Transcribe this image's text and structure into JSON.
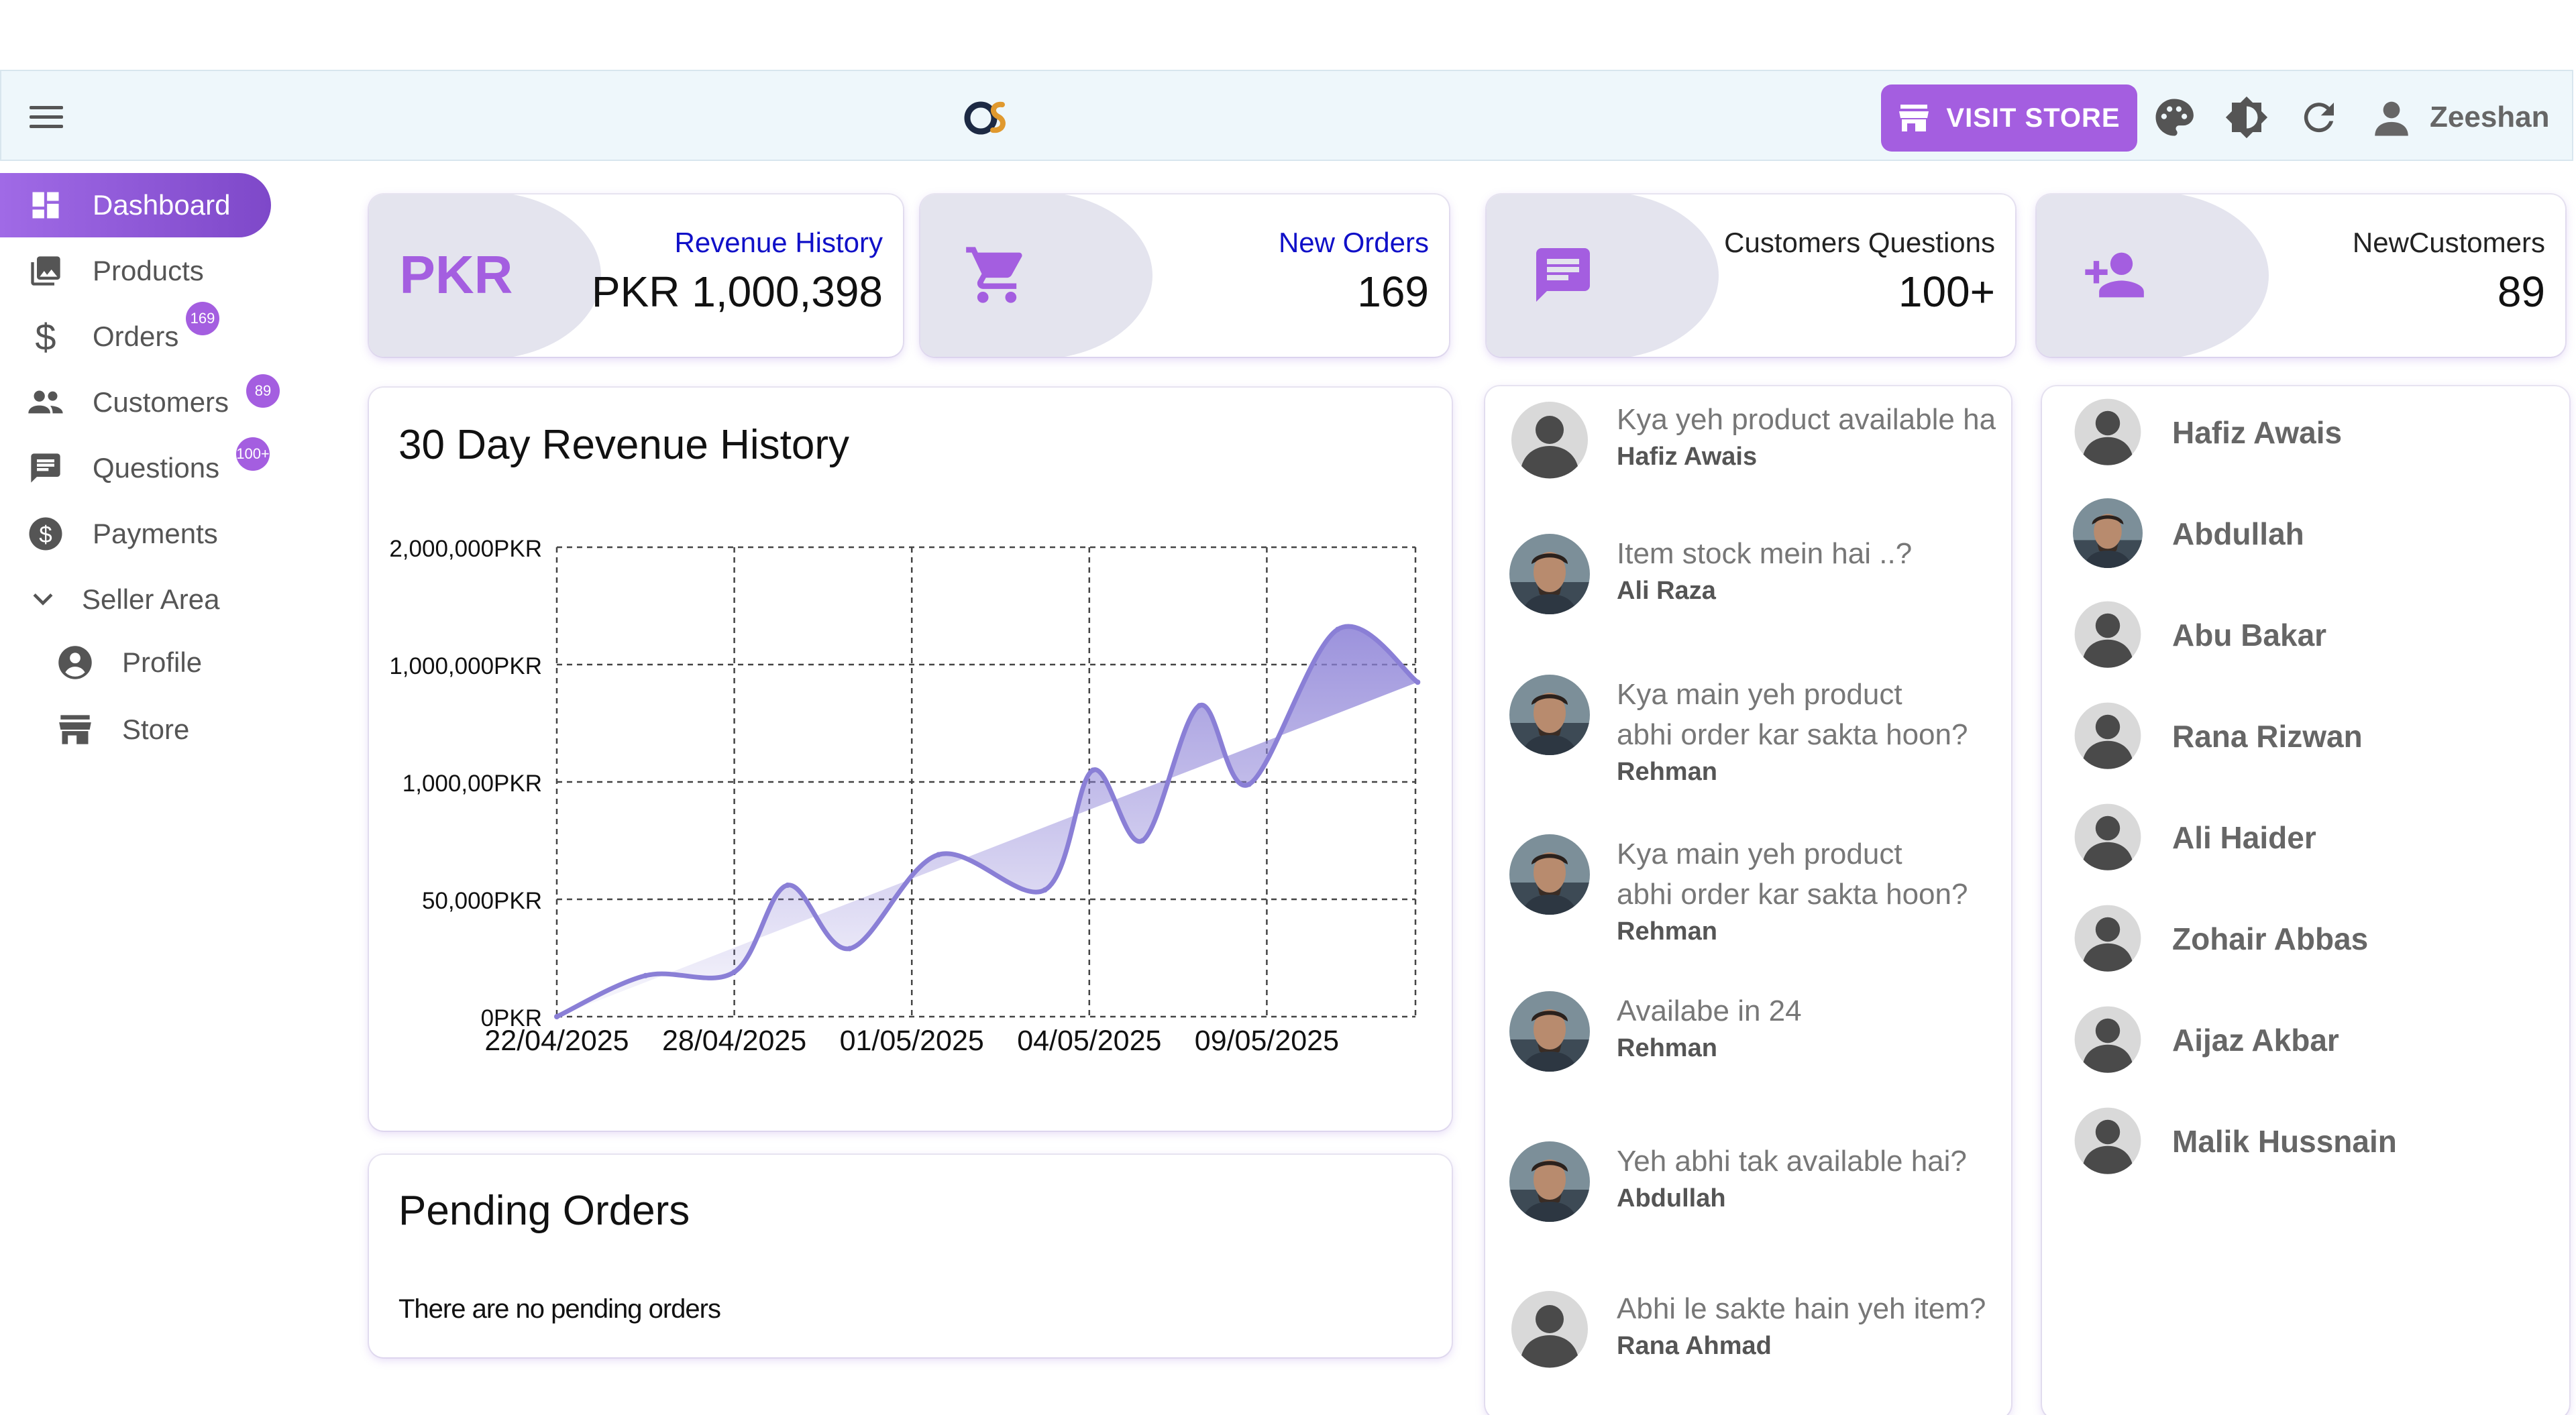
{
  "header": {
    "visit_store_label": "VISIT STORE",
    "user_name": "Zeeshan"
  },
  "sidebar": {
    "items": [
      {
        "label": "Dashboard",
        "icon": "dashboard-icon",
        "active": true
      },
      {
        "label": "Products",
        "icon": "image-icon"
      },
      {
        "label": "Orders",
        "icon": "dollar-icon",
        "badge": "169"
      },
      {
        "label": "Customers",
        "icon": "people-icon",
        "badge": "89"
      },
      {
        "label": "Questions",
        "icon": "message-icon",
        "badge": "100+"
      },
      {
        "label": "Payments",
        "icon": "coin-icon"
      },
      {
        "label": "Seller Area",
        "icon": "chevron-down-icon"
      },
      {
        "label": "Profile",
        "icon": "account-icon"
      },
      {
        "label": "Store",
        "icon": "store-icon"
      }
    ]
  },
  "stats": [
    {
      "title": "Revenue History",
      "value": "PKR 1,000,398",
      "icon_text": "PKR",
      "title_color": "#1010c8"
    },
    {
      "title": "New Orders",
      "value": "169",
      "icon": "cart-icon",
      "title_color": "#1010c8"
    },
    {
      "title": "Customers Questions",
      "value": "100+",
      "icon": "message-icon",
      "title_color": "#111111"
    },
    {
      "title": "NewCustomers",
      "value": "89",
      "icon": "person-add-icon",
      "title_color": "#111111"
    }
  ],
  "revenue_panel": {
    "title": "30 Day Revenue History"
  },
  "chart_data": {
    "type": "area",
    "title": "30 Day Revenue History",
    "y_tick_labels": [
      "0PKR",
      "50,000PKR",
      "1,000,00PKR",
      "1,000,000PKR",
      "2,000,000PKR"
    ],
    "x_tick_labels": [
      "22/04/2025",
      "28/04/2025",
      "01/05/2025",
      "04/05/2025",
      "09/05/2025"
    ],
    "grid": true,
    "series": [
      {
        "color": "#8a7fd6",
        "x": [
          0,
          0.5,
          1,
          1.3,
          1.65,
          2.15,
          2.75,
          3.02,
          3.3,
          3.62,
          3.9,
          4.4,
          4.85
        ],
        "y": [
          0,
          0.35,
          0.38,
          1.12,
          0.58,
          1.38,
          1.08,
          2.1,
          1.5,
          2.65,
          1.98,
          3.3,
          2.85
        ]
      }
    ],
    "accent": "#8a7fd6"
  },
  "pending_panel": {
    "title": "Pending Orders",
    "empty_text": "There are no pending orders"
  },
  "questions": [
    {
      "text": "Kya yeh product available ha",
      "author": "Hafiz Awais",
      "avatar": "default-avatar"
    },
    {
      "text": "Item stock mein hai ..?",
      "author": "Ali Raza",
      "avatar": "photo-avatar"
    },
    {
      "text": "Kya main yeh product\nabhi order kar sakta hoon?",
      "author": "Rehman",
      "avatar": "photo-avatar"
    },
    {
      "text": "Kya main yeh product\nabhi order kar sakta hoon?",
      "author": "Rehman",
      "avatar": "photo-avatar"
    },
    {
      "text": "Availabe in 24",
      "author": "Rehman",
      "avatar": "photo-avatar"
    },
    {
      "text": "Yeh abhi tak available hai?",
      "author": "Abdullah",
      "avatar": "photo-avatar"
    },
    {
      "text": "Abhi le sakte hain yeh item?",
      "author": "Rana Ahmad",
      "avatar": "default-avatar"
    }
  ],
  "customers": [
    {
      "name": "Hafiz Awais",
      "avatar": "default-avatar"
    },
    {
      "name": "Abdullah",
      "avatar": "photo-avatar"
    },
    {
      "name": "Abu Bakar",
      "avatar": "default-avatar"
    },
    {
      "name": "Rana Rizwan",
      "avatar": "default-avatar"
    },
    {
      "name": "Ali Haider",
      "avatar": "default-avatar"
    },
    {
      "name": "Zohair Abbas",
      "avatar": "default-avatar"
    },
    {
      "name": "Aijaz Akbar",
      "avatar": "default-avatar"
    },
    {
      "name": "Malik Hussnain",
      "avatar": "default-avatar"
    }
  ],
  "colors": {
    "accent": "#a45ee0",
    "header_bg": "#eef7fb",
    "card_circle": "#e4e4ee"
  }
}
